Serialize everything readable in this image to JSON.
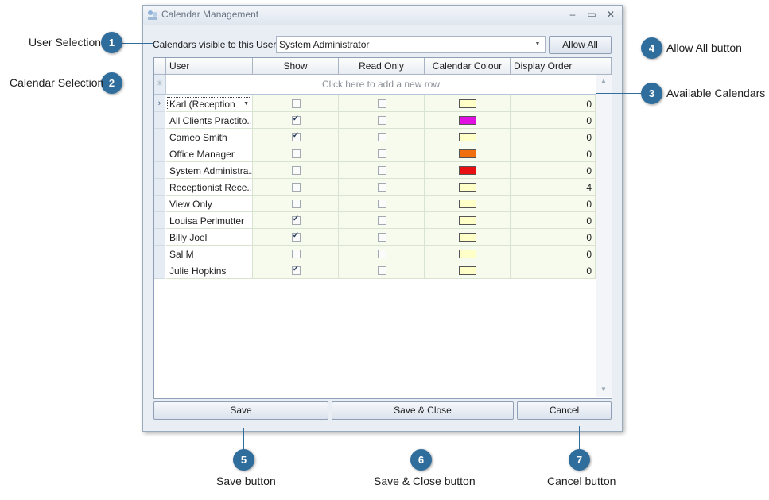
{
  "window": {
    "title": "Calendar Management",
    "minimize_glyph": "–",
    "maximize_glyph": "▭",
    "close_glyph": "✕",
    "icon": "app-icon"
  },
  "user_selection": {
    "label": "Calendars visible to this User...",
    "selected_user": "System Administrator"
  },
  "allow_all_label": "Allow All",
  "grid": {
    "columns": [
      "User",
      "Show",
      "Read Only",
      "Calendar Colour",
      "Display Order"
    ],
    "new_row_text": "Click here to add a new row",
    "rows": [
      {
        "user": "Karl (Reception...",
        "show": false,
        "read_only": false,
        "colour": "#ffffc8",
        "order": "0",
        "editing": true
      },
      {
        "user": "All Clients Practito...",
        "show": true,
        "read_only": false,
        "colour": "#e010e0",
        "order": "0"
      },
      {
        "user": "Cameo Smith",
        "show": true,
        "read_only": false,
        "colour": "#ffffc8",
        "order": "0"
      },
      {
        "user": "Office Manager",
        "show": false,
        "read_only": false,
        "colour": "#f07010",
        "order": "0"
      },
      {
        "user": "System Administra...",
        "show": false,
        "read_only": false,
        "colour": "#e81010",
        "order": "0"
      },
      {
        "user": "Receptionist Rece...",
        "show": false,
        "read_only": false,
        "colour": "#ffffc8",
        "order": "4"
      },
      {
        "user": "View Only",
        "show": false,
        "read_only": false,
        "colour": "#ffffc8",
        "order": "0"
      },
      {
        "user": "Louisa Perlmutter",
        "show": true,
        "read_only": false,
        "colour": "#ffffc8",
        "order": "0"
      },
      {
        "user": "Billy Joel",
        "show": true,
        "read_only": false,
        "colour": "#ffffc8",
        "order": "0"
      },
      {
        "user": "Sal M",
        "show": false,
        "read_only": false,
        "colour": "#ffffc8",
        "order": "0"
      },
      {
        "user": "Julie Hopkins",
        "show": true,
        "read_only": false,
        "colour": "#ffffc8",
        "order": "0"
      }
    ]
  },
  "buttons": {
    "save": "Save",
    "save_close": "Save & Close",
    "cancel": "Cancel"
  },
  "callouts": [
    {
      "number": "1",
      "label": "User Selection"
    },
    {
      "number": "2",
      "label": "Calendar Selection"
    },
    {
      "number": "3",
      "label": "Available Calendars"
    },
    {
      "number": "4",
      "label": "Allow All button"
    },
    {
      "number": "5",
      "label": "Save button"
    },
    {
      "number": "6",
      "label": "Save & Close button"
    },
    {
      "number": "7",
      "label": "Cancel button"
    }
  ],
  "colors": {
    "callout": "#2f6d9c",
    "row_background": "#f6fbee"
  }
}
